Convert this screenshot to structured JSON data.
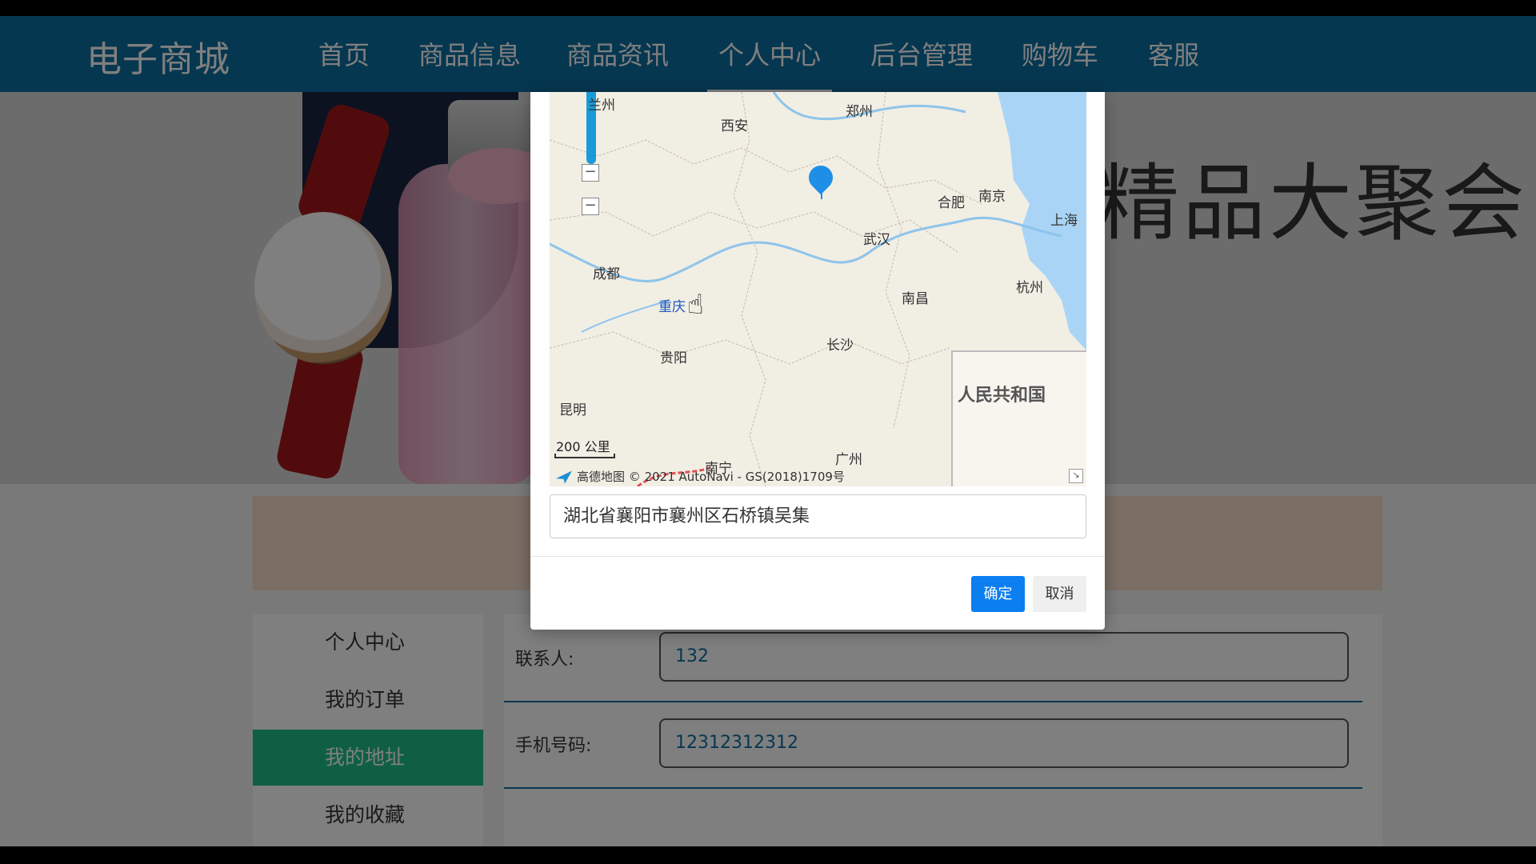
{
  "nav": {
    "logo": "电子商城",
    "items": [
      {
        "label": "首页"
      },
      {
        "label": "商品信息"
      },
      {
        "label": "商品资讯"
      },
      {
        "label": "个人中心"
      },
      {
        "label": "后台管理"
      },
      {
        "label": "购物车"
      },
      {
        "label": "客服"
      }
    ]
  },
  "banner": {
    "text": "精品大聚会!"
  },
  "sidebar": {
    "items": [
      {
        "label": "个人中心"
      },
      {
        "label": "我的订单"
      },
      {
        "label": "我的地址"
      },
      {
        "label": "我的收藏"
      }
    ]
  },
  "form": {
    "contact_label": "联系人:",
    "contact_value": "132",
    "phone_label": "手机号码:",
    "phone_value": "12312312312"
  },
  "map": {
    "cities": [
      "兰州",
      "西安",
      "郑州",
      "合肥",
      "南京",
      "上海",
      "武汉",
      "成都",
      "重庆",
      "杭州",
      "南昌",
      "长沙",
      "贵阳",
      "昆明",
      "南宁",
      "广州"
    ],
    "scale": "200 公里",
    "attribution_logo": "高德地图",
    "attribution": "© 2021 AutoNavi - GS(2018)1709号",
    "inset_label": "人民共和国"
  },
  "modal": {
    "address": "湖北省襄阳市襄州区石桥镇吴集",
    "confirm": "确定",
    "cancel": "取消"
  },
  "colors": {
    "nav": "#0d6fa0",
    "accent_green": "#1fbf8a",
    "confirm_blue": "#0b7ef0"
  }
}
